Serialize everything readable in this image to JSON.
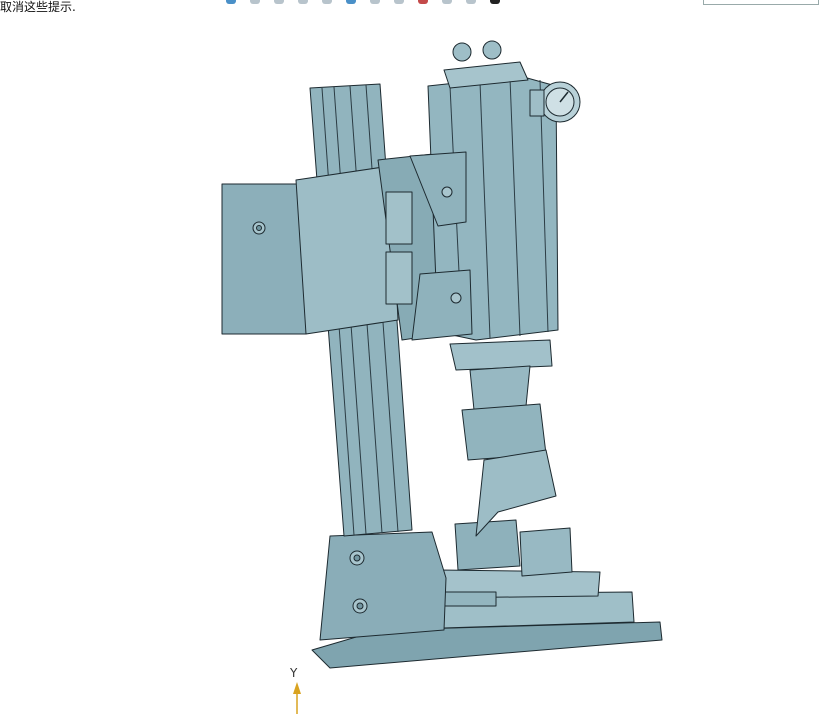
{
  "hint_text": "取消这些提示.",
  "triad": {
    "axis_y_label": "Y"
  },
  "colors": {
    "model_fill": "#8fb3bf",
    "model_light": "#a9c6cf",
    "model_dark": "#6f959f",
    "edge": "#1d2a30",
    "axis": "#d9a320"
  },
  "icons": [
    "toolbar-icon",
    "model-view-icon",
    "axis-triad-icon"
  ]
}
